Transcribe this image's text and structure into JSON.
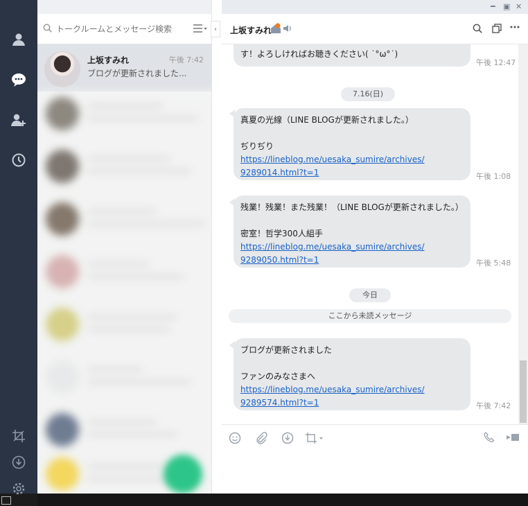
{
  "sidebar": {
    "icons": [
      "user-icon",
      "chat-icon",
      "add-friend-icon",
      "clock-icon",
      "crop-icon",
      "download-icon",
      "gear-icon"
    ]
  },
  "search": {
    "placeholder": "トークルームとメッセージ検索"
  },
  "chat_list": {
    "active": {
      "name": "上坂すみれ",
      "time": "午後 7:42",
      "preview": "ブログが更新されました..."
    }
  },
  "chat": {
    "title": "上坂すみれ",
    "messages": [
      {
        "lines": [
          "す！よろしければお聴きください( ˙°ω°˙)"
        ],
        "links": [],
        "time": "午後 12:47"
      },
      {
        "lines": [
          "真夏の光線（LINE BLOGが更新されました。）",
          "",
          "ぢりぢり"
        ],
        "links": [
          "https://lineblog.me/uesaka_sumire/archives/",
          "9289014.html?t=1"
        ],
        "time": "午後 1:08"
      },
      {
        "lines": [
          "残業！残業！また残業！（LINE BLOGが更新されました。）",
          "",
          "密室！哲学300人組手"
        ],
        "links": [
          "https://lineblog.me/uesaka_sumire/archives/",
          "9289050.html?t=1"
        ],
        "time": "午後 5:48"
      },
      {
        "lines": [
          "ブログが更新されました",
          "",
          "ファンのみなさまへ"
        ],
        "links": [
          "https://lineblog.me/uesaka_sumire/archives/",
          "9289574.html?t=1"
        ],
        "time": "午後 7:42"
      }
    ],
    "date_separators": [
      "7.16(日)",
      "今日"
    ],
    "unread_label": "ここから未読メッセージ"
  },
  "colors": {
    "rail": "#2a3445",
    "bubble": "#e6e8ea",
    "link": "#1a62c8",
    "fab": "#2ec58a"
  }
}
